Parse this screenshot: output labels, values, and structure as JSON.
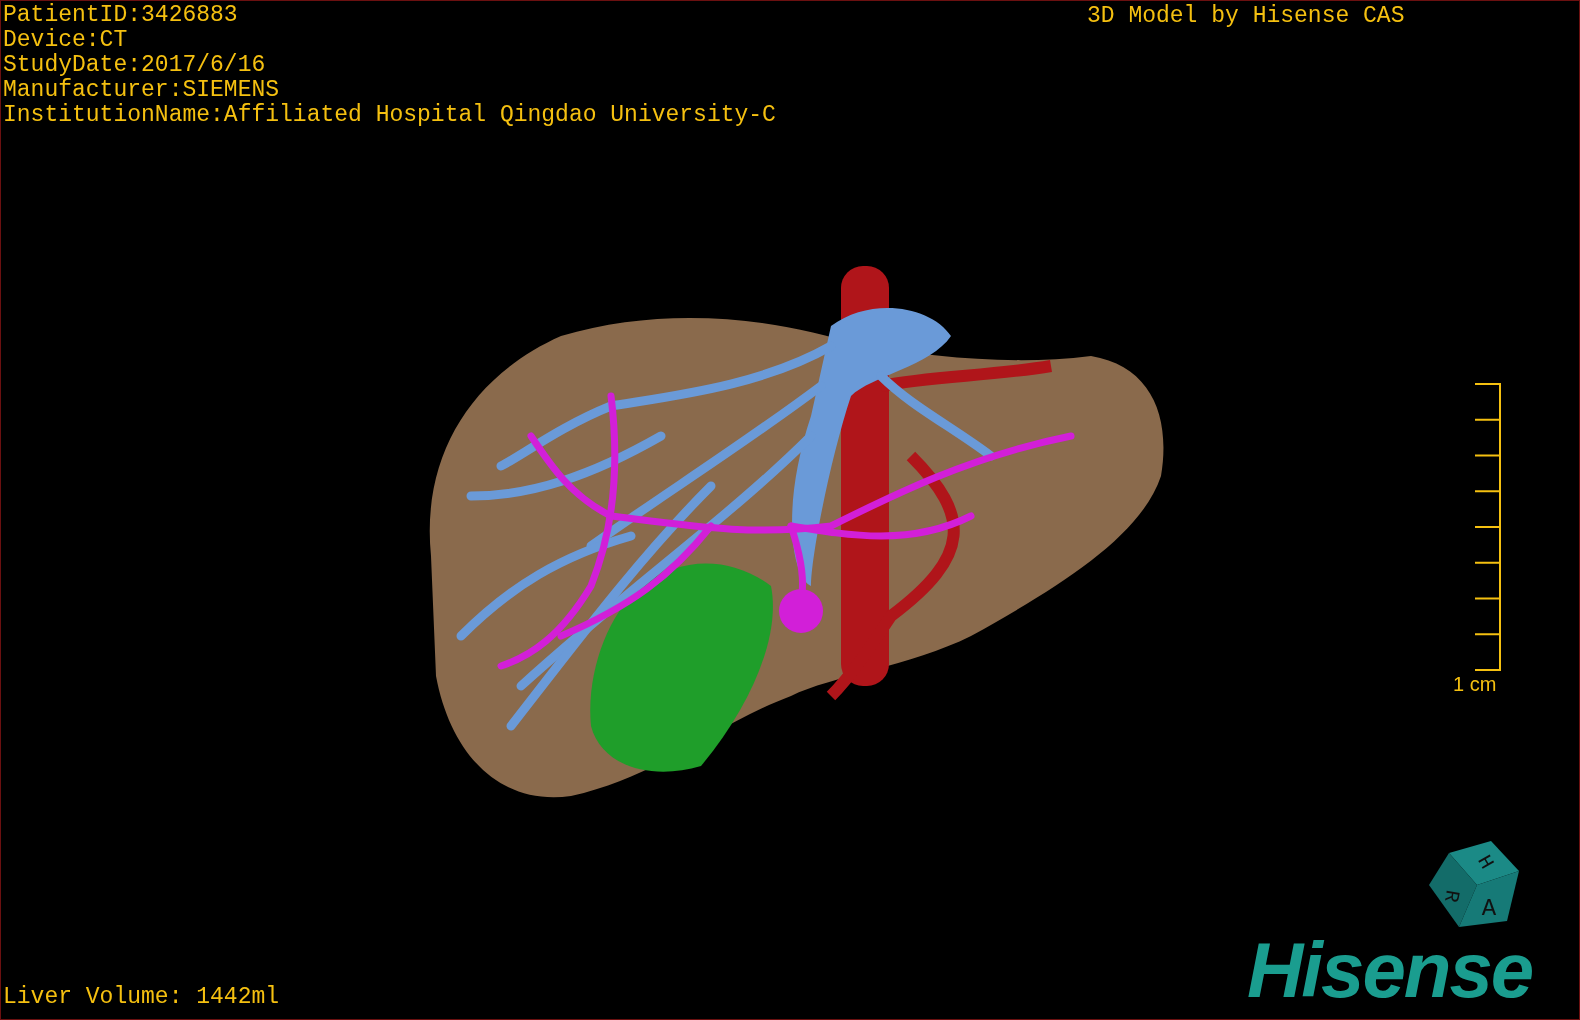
{
  "info_lines": [
    "PatientID:3426883",
    "Device:CT",
    "StudyDate:2017/6/16",
    "Manufacturer:SIEMENS",
    "InstitutionName:Affiliated Hospital Qingdao University-C"
  ],
  "model_credit": "3D Model by Hisense CAS",
  "scale_bar": {
    "label": "1 cm"
  },
  "orientation_cube": {
    "faces": [
      "H",
      "R",
      "A"
    ]
  },
  "logo": "Hisense",
  "liver_volume": "Liver Volume: 1442ml"
}
